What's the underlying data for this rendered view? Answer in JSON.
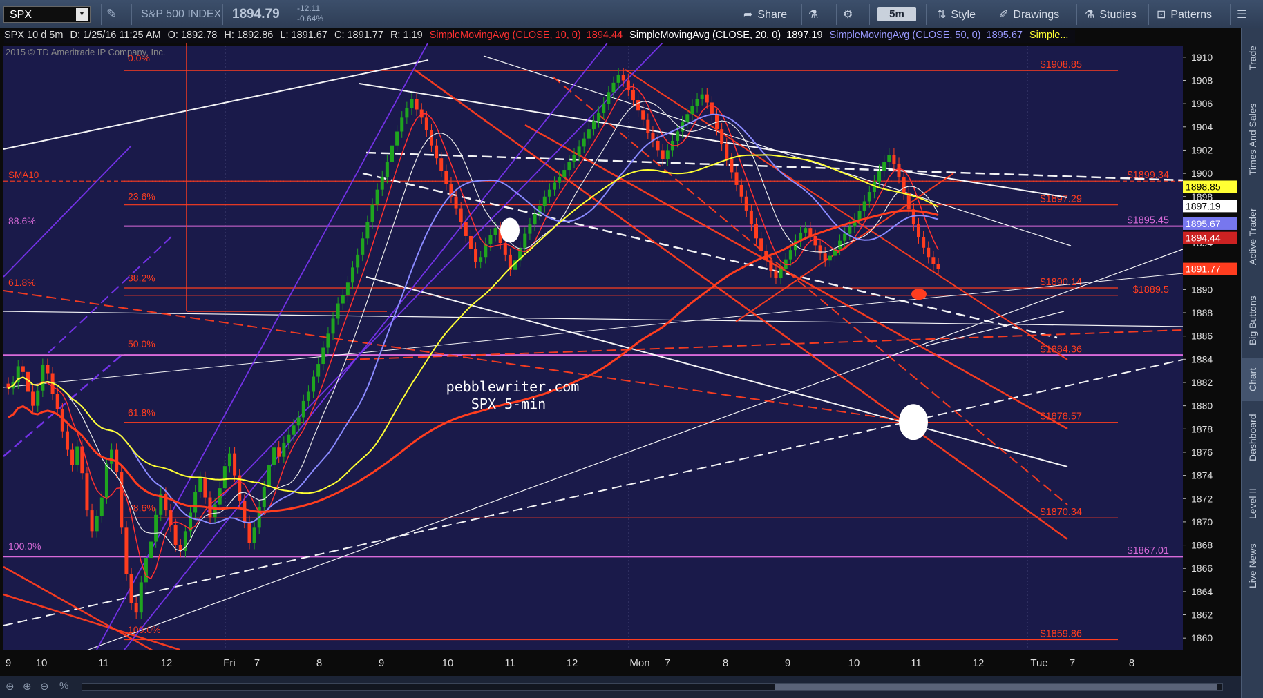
{
  "toolbar": {
    "symbol": "SPX",
    "index_name": "S&P 500 INDEX",
    "last_price": "1894.79",
    "change": "-12.11",
    "change_pct": "-0.64%",
    "share_label": "Share",
    "timeframe": "5m",
    "style_label": "Style",
    "drawings_label": "Drawings",
    "studies_label": "Studies",
    "patterns_label": "Patterns"
  },
  "info_bar": {
    "symbol_period": "SPX 10 d 5m",
    "date": "D: 1/25/16 11:25 AM",
    "open": "O: 1892.78",
    "high": "H: 1892.86",
    "low": "L: 1891.67",
    "close": "C: 1891.77",
    "range": "R: 1.19",
    "sma10_label": "SimpleMovingAvg (CLOSE, 10, 0)",
    "sma10_value": "1894.44",
    "sma20_label": "SimpleMovingAvg (CLOSE, 20, 0)",
    "sma20_value": "1897.19",
    "sma50_label": "SimpleMovingAvg (CLOSE, 50, 0)",
    "sma50_value": "1895.67",
    "more_label": "Simple...",
    "copyright": "2015 © TD Ameritrade IP Company, Inc."
  },
  "right_rail": [
    "Trade",
    "Times And Sales",
    "Active Trader",
    "Big Buttons",
    "Chart",
    "Dashboard",
    "Level II",
    "Live News"
  ],
  "colors": {
    "background": "#1a1a4a",
    "candle_up": "#1fa51f",
    "candle_down": "#ff3d1f",
    "sma10": "#ff3030",
    "sma20": "#e8e8e8",
    "sma50": "#8a8aff",
    "sma100": "#ffff33",
    "sma200": "#ff3d1f",
    "fib_line": "#ff3d1f",
    "magenta_line": "#d96bd9",
    "white_line": "#ffffff",
    "purple_channel": "#7733ee"
  },
  "chart_data": {
    "type": "candlestick",
    "title": "pebblewriter.com",
    "subtitle": "SPX 5-min",
    "ylim": [
      1859,
      1911
    ],
    "y_ticks": [
      1860,
      1862,
      1864,
      1866,
      1868,
      1870,
      1872,
      1874,
      1876,
      1878,
      1880,
      1882,
      1884,
      1886,
      1888,
      1890,
      1892,
      1894,
      1896,
      1898,
      1900,
      1902,
      1904,
      1906,
      1908,
      1910
    ],
    "x_ticks": [
      "9",
      "10",
      "11",
      "12",
      "Fri",
      "7",
      "8",
      "9",
      "10",
      "11",
      "12",
      "Mon",
      "7",
      "8",
      "9",
      "10",
      "11",
      "12",
      "Tue",
      "7",
      "8"
    ],
    "price_badges": [
      {
        "label": "1898.85",
        "value": 1898.85,
        "bg": "#ffff33",
        "fg": "#000"
      },
      {
        "label": "1897.19",
        "value": 1897.19,
        "bg": "#ffffff",
        "fg": "#000"
      },
      {
        "label": "1895.67",
        "value": 1895.67,
        "bg": "#7777ee",
        "fg": "#fff"
      },
      {
        "label": "1894.44",
        "value": 1894.44,
        "bg": "#cc2222",
        "fg": "#fff"
      },
      {
        "label": "1891.77",
        "value": 1891.77,
        "bg": "#ff3d1f",
        "fg": "#fff"
      }
    ],
    "fib_left_labels": [
      {
        "label": "0.0%",
        "value": 1909.5,
        "color": "#ff3d1f"
      },
      {
        "label": "23.6%",
        "value": 1897.6,
        "color": "#ff3d1f"
      },
      {
        "label": "88.6%",
        "value": 1895.5,
        "color": "#d96bd9"
      },
      {
        "label": "38.2%",
        "value": 1890.6,
        "color": "#ff3d1f"
      },
      {
        "label": "61.8%",
        "value": 1890.2,
        "color": "#ff3d1f"
      },
      {
        "label": "50.0%",
        "value": 1884.9,
        "color": "#ff3d1f"
      },
      {
        "label": "61.8%",
        "value": 1879.0,
        "color": "#ff3d1f"
      },
      {
        "label": "78.6%",
        "value": 1870.8,
        "color": "#ff3d1f"
      },
      {
        "label": "100.0%",
        "value": 1867.5,
        "color": "#d96bd9"
      },
      {
        "label": "100.0%",
        "value": 1860.3,
        "color": "#ff3d1f"
      }
    ],
    "level_lines": [
      {
        "label": "$1908.85",
        "value": 1908.85,
        "color": "#ff3d1f",
        "label_color": "#ff3d1f"
      },
      {
        "label": "$1899.34",
        "value": 1899.34,
        "color": "#ff3d1f",
        "dashed": true,
        "label_color": "#ff3d1f"
      },
      {
        "label": "$1897.29",
        "value": 1897.29,
        "color": "#ff3d1f",
        "label_color": "#ff3d1f"
      },
      {
        "label": "$1895.45",
        "value": 1895.45,
        "color": "#d96bd9",
        "label_color": "#d96bd9"
      },
      {
        "label": "$1890.14",
        "value": 1890.14,
        "color": "#ff3d1f",
        "label_color": "#ff3d1f"
      },
      {
        "label": "$1889.5",
        "value": 1889.5,
        "color": "#ff3d1f",
        "label_color": "#ff3d1f"
      },
      {
        "label": "$1884.36",
        "value": 1884.36,
        "color": "#d96bd9",
        "label_color": "#ff3d1f"
      },
      {
        "label": "$1878.57",
        "value": 1878.57,
        "color": "#ff3d1f",
        "label_color": "#ff3d1f"
      },
      {
        "label": "$1870.34",
        "value": 1870.34,
        "color": "#ff3d1f",
        "label_color": "#ff3d1f"
      },
      {
        "label": "$1867.01",
        "value": 1867.01,
        "color": "#d96bd9",
        "label_color": "#d96bd9"
      },
      {
        "label": "$1859.86",
        "value": 1859.86,
        "color": "#ff3d1f",
        "label_color": "#ff3d1f"
      }
    ],
    "sma10_label": "SMA10",
    "last_close": 1891.77,
    "series_close": [
      1881.5,
      1882.0,
      1883.4,
      1882.9,
      1881.2,
      1880.0,
      1881.3,
      1883.5,
      1882.8,
      1881.0,
      1879.7,
      1877.8,
      1876.2,
      1874.9,
      1876.5,
      1874.2,
      1871.0,
      1869.2,
      1870.5,
      1872.1,
      1875.0,
      1876.2,
      1874.3,
      1869.5,
      1865.5,
      1863.0,
      1862.2,
      1864.8,
      1866.9,
      1868.3,
      1870.6,
      1872.4,
      1871.0,
      1869.7,
      1868.0,
      1867.5,
      1869.2,
      1870.8,
      1872.6,
      1873.8,
      1872.1,
      1870.4,
      1871.5,
      1872.9,
      1874.8,
      1875.9,
      1874.0,
      1871.8,
      1870.0,
      1868.2,
      1869.5,
      1871.3,
      1873.0,
      1874.9,
      1876.4,
      1875.6,
      1876.8,
      1877.5,
      1878.3,
      1879.0,
      1880.4,
      1881.2,
      1882.5,
      1883.6,
      1885.0,
      1886.2,
      1887.5,
      1888.8,
      1889.5,
      1890.6,
      1891.9,
      1893.0,
      1894.4,
      1895.8,
      1897.3,
      1898.6,
      1899.7,
      1901.0,
      1902.4,
      1903.6,
      1904.8,
      1905.6,
      1906.4,
      1905.5,
      1904.8,
      1903.7,
      1902.4,
      1901.3,
      1900.2,
      1899.1,
      1898.0,
      1897.0,
      1895.8,
      1894.6,
      1893.5,
      1892.4,
      1892.8,
      1893.9,
      1894.7,
      1895.3,
      1894.0,
      1893.0,
      1891.7,
      1892.5,
      1893.6,
      1894.8,
      1895.6,
      1896.5,
      1897.2,
      1898.0,
      1898.6,
      1899.2,
      1899.7,
      1900.3,
      1901.0,
      1901.6,
      1902.3,
      1903.0,
      1903.8,
      1904.5,
      1905.2,
      1906.0,
      1907.0,
      1907.8,
      1908.5,
      1908.0,
      1907.2,
      1906.3,
      1905.4,
      1904.6,
      1903.5,
      1902.8,
      1902.0,
      1901.2,
      1902.0,
      1902.8,
      1903.6,
      1904.4,
      1905.1,
      1905.8,
      1906.4,
      1906.8,
      1906.1,
      1905.0,
      1903.8,
      1902.5,
      1901.2,
      1900.1,
      1899.0,
      1898.0,
      1896.8,
      1895.6,
      1894.4,
      1893.3,
      1892.5,
      1891.6,
      1891.0,
      1891.8,
      1892.6,
      1893.4,
      1894.2,
      1894.9,
      1895.3,
      1894.6,
      1893.8,
      1893.1,
      1892.5,
      1892.9,
      1893.5,
      1894.2,
      1894.8,
      1895.4,
      1896.0,
      1896.8,
      1897.6,
      1898.4,
      1899.3,
      1900.2,
      1901.0,
      1901.6,
      1900.8,
      1899.7,
      1898.3,
      1896.9,
      1895.6,
      1894.5,
      1893.6,
      1892.8,
      1892.2,
      1891.77
    ]
  }
}
